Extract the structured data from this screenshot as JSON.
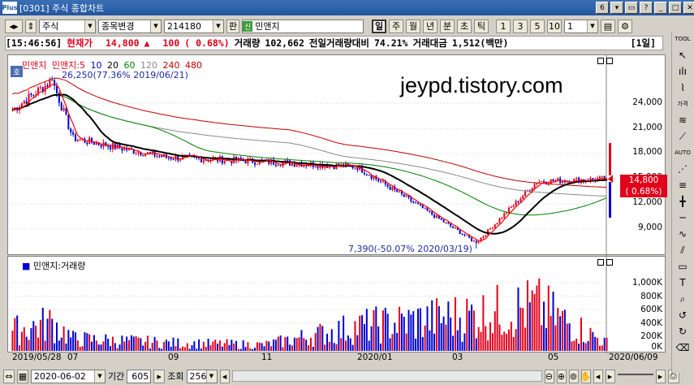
{
  "window": {
    "title": "[0301] 주식 종합차트",
    "app_icon": "Plus",
    "tab_count": "6"
  },
  "toolbar": {
    "market": "주식",
    "change_button": "종목변경",
    "code": "214180",
    "pan_button": "판",
    "sin_badge": "신",
    "stock_name": "민앤지",
    "periods": [
      "일",
      "주",
      "월",
      "년",
      "분",
      "초",
      "틱"
    ],
    "active_period": "일",
    "intervals": [
      "1",
      "3",
      "5",
      "10"
    ],
    "interval_value": "1"
  },
  "quote": {
    "time": "[15:46:56]",
    "price_label": "현재가",
    "price": "14,800",
    "arrow": "▲",
    "change": "100",
    "change_pct": "( 0.68%)",
    "volume_label": "거래량",
    "volume": "102,662",
    "prev_ratio_label": "전일거래량대비",
    "prev_ratio": "74.21%",
    "amount_label": "거래대금",
    "amount": "1,512(백만)",
    "chart_count": "[1일]"
  },
  "price_panel": {
    "legend": {
      "name": "민앤지",
      "ma": [
        "민앤지:5",
        "10",
        "20",
        "60",
        "120",
        "240",
        "480"
      ]
    },
    "badge": "호",
    "watermark": "jeypd.tistory.com",
    "high_annotation": "26,250(77.36% 2019/06/21)",
    "low_annotation": "7,390(-50.07% 2020/03/19)",
    "current_tag": "14,800",
    "current_pct_tag": "( 0.68%)",
    "y_ticks": [
      "24,000",
      "21,000",
      "18,000",
      "15,000",
      "12,000",
      "9,000"
    ]
  },
  "volume_panel": {
    "legend": "민앤지:거래량",
    "y_ticks": [
      "1,000K",
      "800K",
      "600K",
      "400K",
      "200K",
      "0K"
    ]
  },
  "x_axis": {
    "start_label": "2019/05/28",
    "ticks": [
      "07",
      "09",
      "11",
      "2020/01",
      "03",
      "05"
    ],
    "end_label": "2020/06/09"
  },
  "bottom": {
    "date": "2020-06-02",
    "period_label": "기간",
    "period_value": "605",
    "query_label": "조회",
    "count_value": "256"
  },
  "right_tools": [
    "TOOL",
    "가격",
    "AUTO"
  ],
  "colors": {
    "up": "#e0001b",
    "down": "#0000d0",
    "ma5": "#ff0000",
    "ma20": "#000000",
    "ma60": "#008000",
    "ma120": "#8a8a8a",
    "ma240": "#c00000"
  },
  "chart_data": {
    "type": "line",
    "title": "",
    "x": [
      "2019/05/28",
      "2019/06/21",
      "2019/07",
      "2019/09",
      "2019/11",
      "2020/01",
      "2020/03/19",
      "2020/05",
      "2020/06/09"
    ],
    "series": [
      {
        "name": "민앤지",
        "values": [
          22800,
          26250,
          19500,
          17300,
          16800,
          16200,
          7390,
          14500,
          14800
        ]
      }
    ],
    "ylim": [
      7000,
      26500
    ],
    "volume": [
      500,
      700,
      300,
      200,
      150,
      600,
      900,
      1100,
      200
    ]
  }
}
